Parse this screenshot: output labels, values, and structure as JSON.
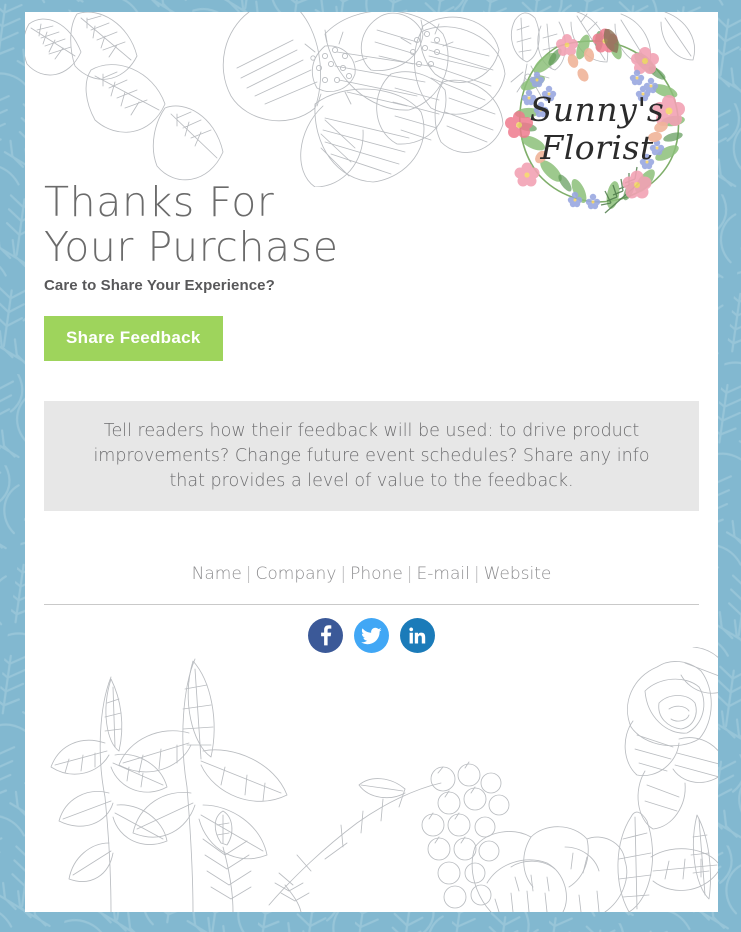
{
  "theme": {
    "border_color": "#82b8d0",
    "card_background": "#ffffff",
    "accent_button_color": "#9ed45c",
    "message_box_color": "#e7e7e7",
    "heading_color": "#6b6b6b",
    "body_text_color": "#6e6e70",
    "divider_color": "#c9c9c9"
  },
  "hero": {
    "title": "Thanks For\nYour Purchase",
    "subtitle": "Care to Share Your Experience?",
    "cta_label": "Share Feedback"
  },
  "logo": {
    "name": "sunnys-florist-wreath-logo",
    "line1": "Sunny's",
    "line2": "Florist",
    "alt": "Watercolor floral wreath with script text"
  },
  "message": {
    "text": "Tell readers how their feedback will be used: to drive product improvements? Change future event schedules? Share any info that provides a level of value to the feedback."
  },
  "footer": {
    "links": [
      "Name",
      "Company",
      "Phone",
      "E-mail",
      "Website"
    ],
    "separator": "|"
  },
  "social": [
    {
      "name": "facebook",
      "label": "Facebook",
      "color": "#3b5998"
    },
    {
      "name": "twitter",
      "label": "Twitter",
      "color": "#41a7f5"
    },
    {
      "name": "linkedin",
      "label": "LinkedIn",
      "color": "#1b7bb9"
    }
  ],
  "decor": {
    "top_band": "botanical-line-art-flowers-leaves",
    "bottom_band": "botanical-line-art-peony-berries",
    "border": "blue-leaf-vein-pattern"
  }
}
